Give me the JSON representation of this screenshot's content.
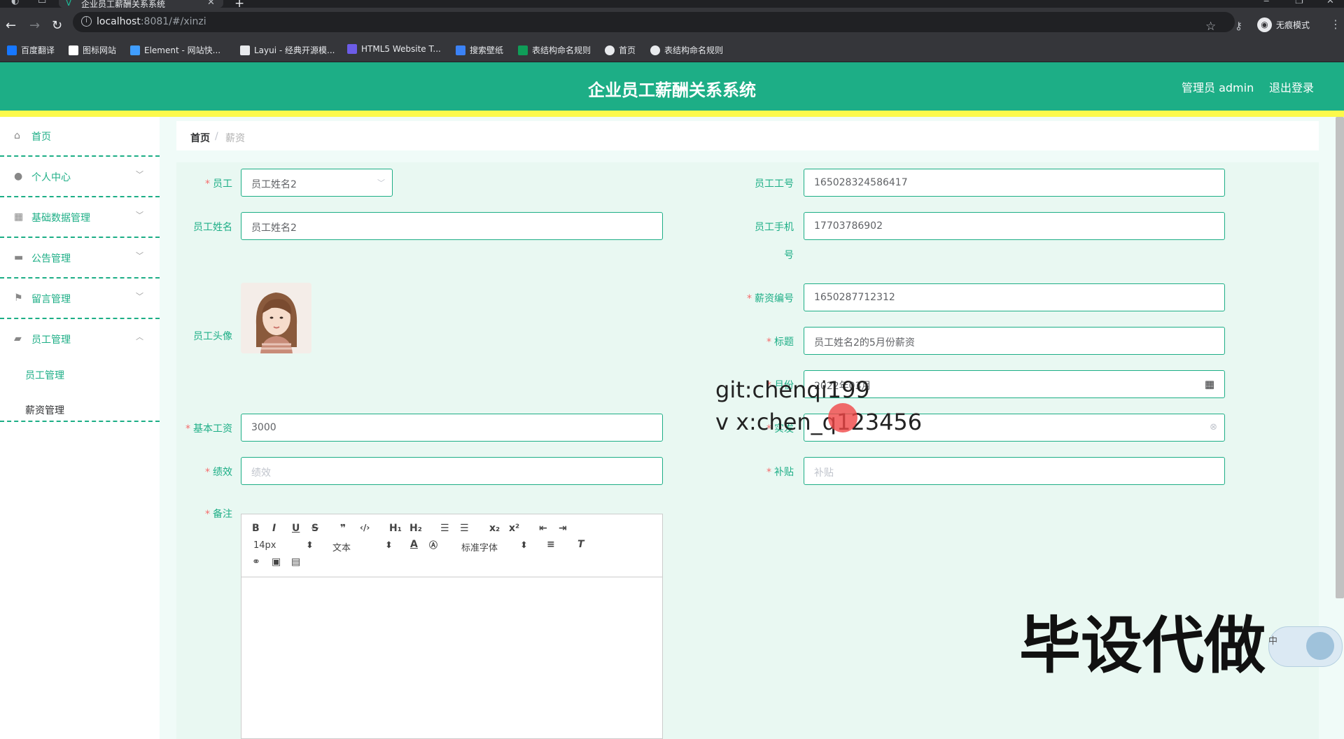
{
  "browser": {
    "tab_title": "企业员工薪酬关系系统",
    "new_tab": "+",
    "url_host": "localhost",
    "url_rest": ":8081/#/xinzi",
    "incognito_label": "无痕模式",
    "bookmarks": [
      {
        "label": "百度翻译",
        "color": "#1677ff"
      },
      {
        "label": "图标网站",
        "color": "#ffffff"
      },
      {
        "label": "Element - 网站快...",
        "color": "#409eff"
      },
      {
        "label": "Layui - 经典开源模...",
        "color": "#e8eaed"
      },
      {
        "label": "HTML5 Website T...",
        "color": "#6c5ce7"
      },
      {
        "label": "搜索壁纸",
        "color": "#3b82f6"
      },
      {
        "label": "表结构命名规则",
        "color": "#0f9d58"
      },
      {
        "label": "首页",
        "color": "#e8eaed"
      },
      {
        "label": "表结构命名规则",
        "color": "#e8eaed"
      }
    ]
  },
  "header": {
    "title": "企业员工薪酬关系系统",
    "user": "管理员 admin",
    "logout": "退出登录"
  },
  "sidebar": {
    "items": [
      {
        "label": "首页",
        "icon": "home-icon"
      },
      {
        "label": "个人中心",
        "icon": "user-icon"
      },
      {
        "label": "基础数据管理",
        "icon": "grid-icon"
      },
      {
        "label": "公告管理",
        "icon": "monitor-icon"
      },
      {
        "label": "留言管理",
        "icon": "flag-icon"
      },
      {
        "label": "员工管理",
        "icon": "briefcase-icon"
      }
    ],
    "sub_items": [
      {
        "label": "员工管理"
      },
      {
        "label": "薪资管理"
      }
    ]
  },
  "breadcrumb": {
    "home": "首页",
    "sep": "/",
    "current": "薪资"
  },
  "form": {
    "employee_label": "员工",
    "employee_value": "员工姓名2",
    "emp_no_label": "员工工号",
    "emp_no_value": "165028324586417",
    "emp_name_label": "员工姓名",
    "emp_name_value": "员工姓名2",
    "phone_label_1": "员工手机",
    "phone_label_2": "号",
    "phone_value": "17703786902",
    "avatar_label": "员工头像",
    "salary_no_label": "薪资编号",
    "salary_no_value": "1650287712312",
    "title_label": "标题",
    "title_value": "员工姓名2的5月份薪资",
    "month_label": "月份",
    "month_value": "2022年03月",
    "base_label": "基本工资",
    "base_value": "3000",
    "actual_label": "实发",
    "actual_value": "",
    "perf_label": "绩效",
    "perf_placeholder": "绩效",
    "subsidy_label": "补贴",
    "subsidy_placeholder": "补贴",
    "remark_label": "备注"
  },
  "editor": {
    "font_size": "14px",
    "paragraph": "文本",
    "font_family": "标准字体"
  },
  "overlay": {
    "git": "git:chenqi199",
    "vx": "v x:chen_q123456",
    "banner": "毕设代做",
    "float_label": "中"
  }
}
